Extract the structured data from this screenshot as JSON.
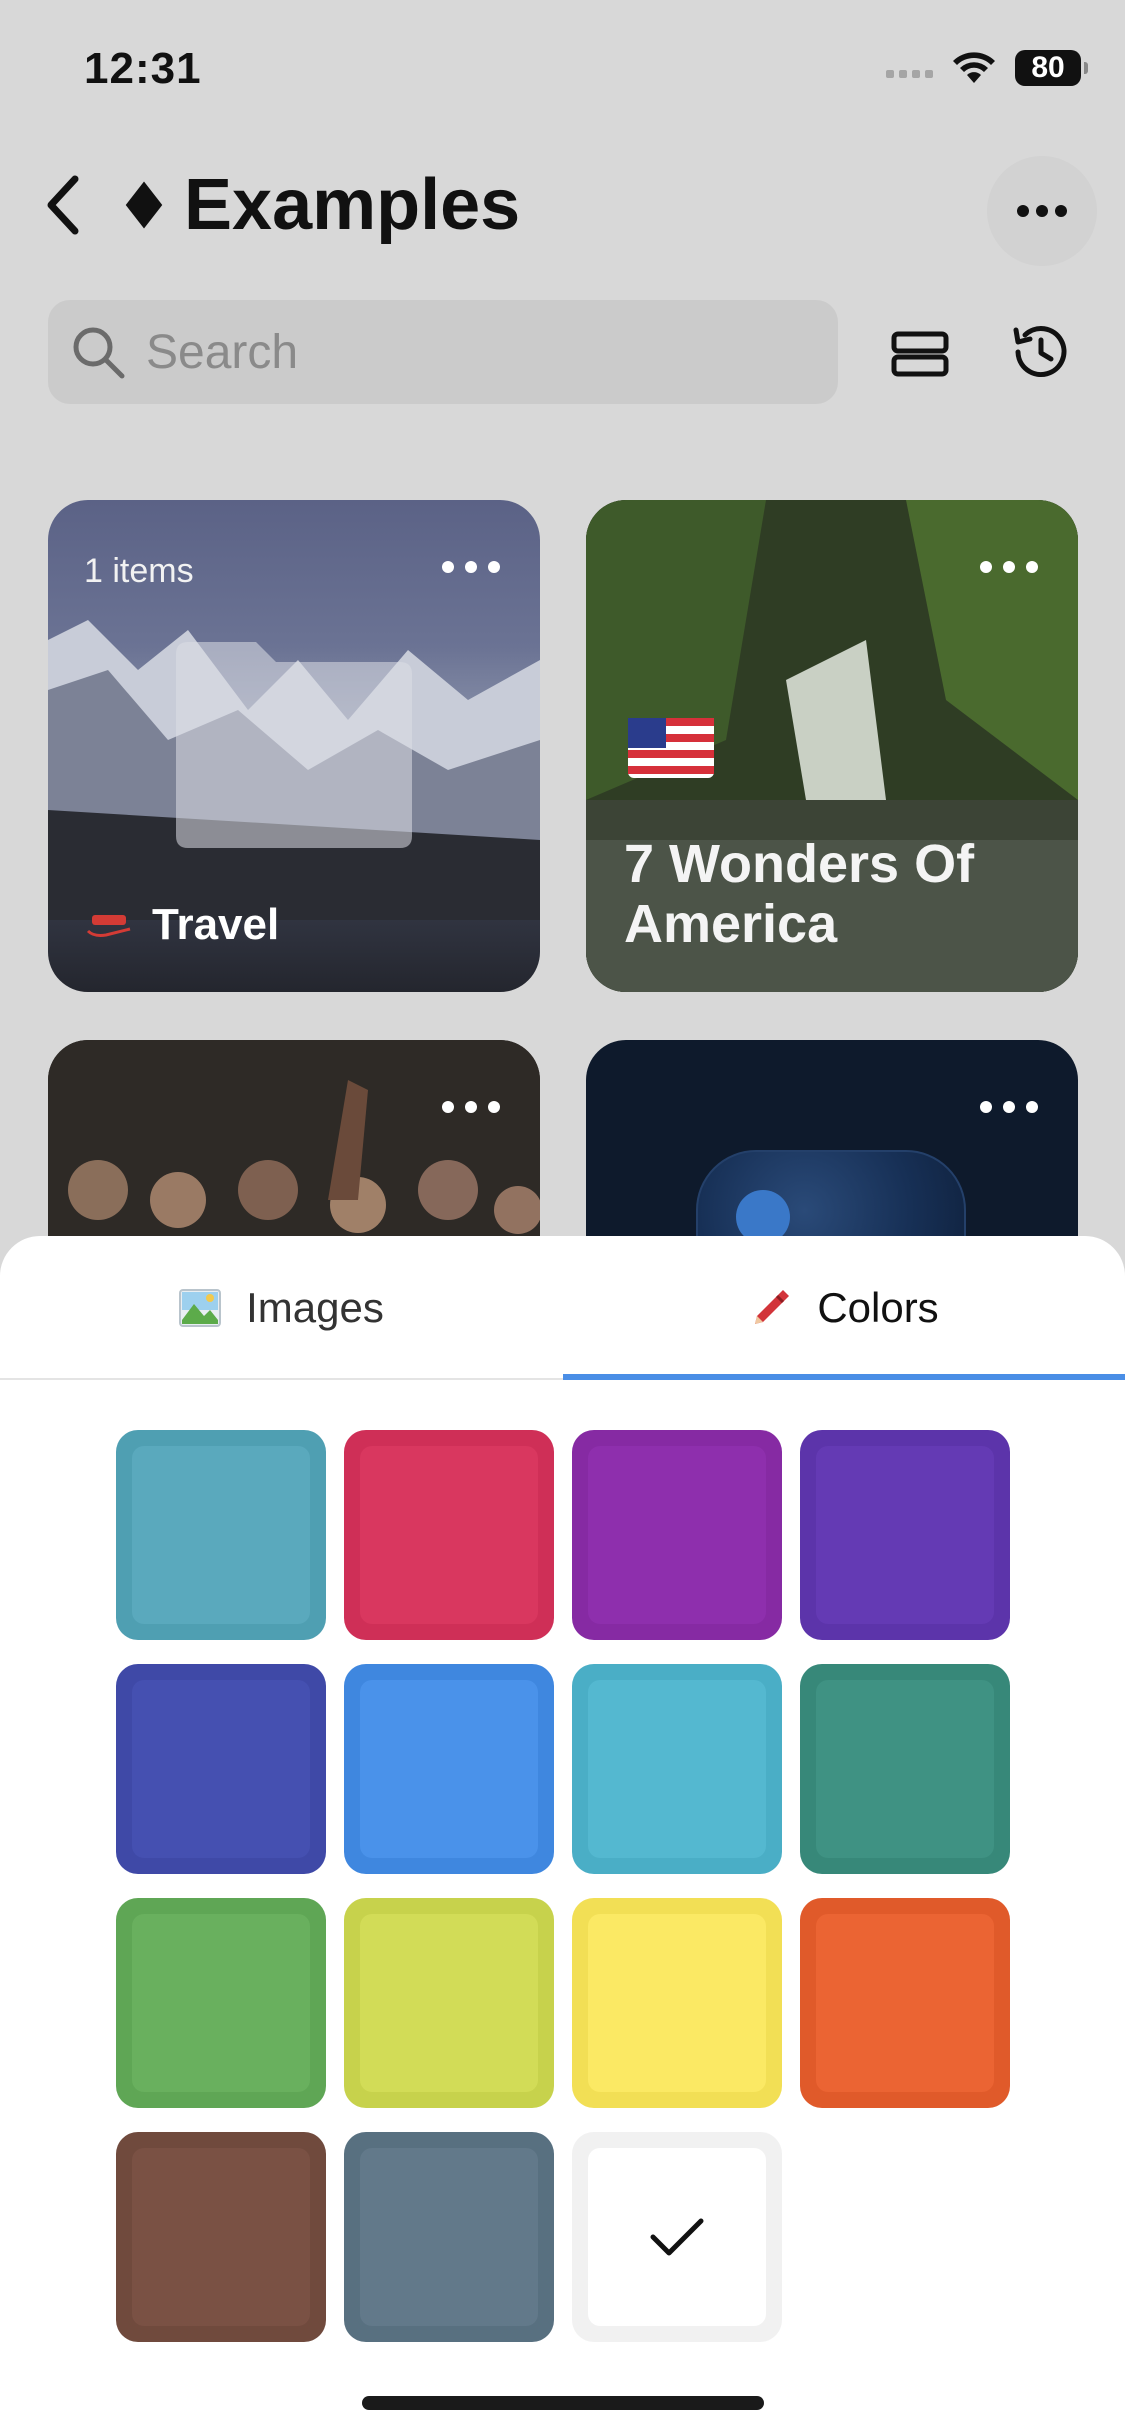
{
  "status_bar": {
    "time": "12:31",
    "battery": "80"
  },
  "header": {
    "title": "Examples"
  },
  "search": {
    "placeholder": "Search"
  },
  "cards": [
    {
      "title": "Travel",
      "count_label": "1 items"
    },
    {
      "title": "7 Wonders Of America"
    },
    {
      "title": ""
    },
    {
      "title": ""
    }
  ],
  "sheet": {
    "tabs": [
      {
        "label": "Images",
        "icon": "picture-icon",
        "selected": false
      },
      {
        "label": "Colors",
        "icon": "crayon-icon",
        "selected": true
      }
    ],
    "swatches": [
      {
        "fill": "#5aa9bd",
        "edge": "#4f9fb2"
      },
      {
        "fill": "#d9375f",
        "edge": "#cf2f57"
      },
      {
        "fill": "#8e2fad",
        "edge": "#862aa3"
      },
      {
        "fill": "#643ab4",
        "edge": "#5c34aa"
      },
      {
        "fill": "#4550b1",
        "edge": "#3f49a7"
      },
      {
        "fill": "#4a92ea",
        "edge": "#3f87df"
      },
      {
        "fill": "#54b8d0",
        "edge": "#4aaec6"
      },
      {
        "fill": "#3f9283",
        "edge": "#378879"
      },
      {
        "fill": "#69b05e",
        "edge": "#5fa655"
      },
      {
        "fill": "#d2dc57",
        "edge": "#c7d24c"
      },
      {
        "fill": "#fbe964",
        "edge": "#f2df55"
      },
      {
        "fill": "#eb6433",
        "edge": "#e05a2a"
      },
      {
        "fill": "#7a5144",
        "edge": "#704a3d"
      },
      {
        "fill": "#62798a",
        "edge": "#587080"
      },
      {
        "fill": "#ffffff",
        "edge": "#f1f1f1",
        "selected": true
      }
    ]
  }
}
